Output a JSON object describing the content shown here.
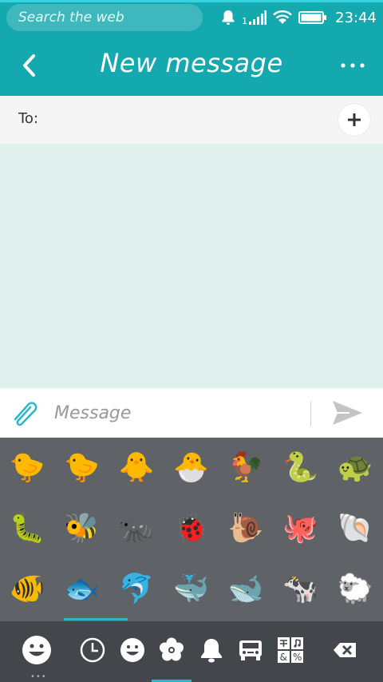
{
  "status_bar": {
    "search_placeholder": "Search the web",
    "sim_number": "1",
    "time": "23:44",
    "icons": [
      "bell-icon",
      "signal-icon",
      "wifi-icon",
      "battery-icon"
    ]
  },
  "header": {
    "title": "New message",
    "back_icon": "chevron-left-icon",
    "menu_icon": "more-horizontal-icon",
    "color": "#14a9ae"
  },
  "recipients": {
    "label": "To:",
    "add_icon": "plus-icon"
  },
  "compose": {
    "placeholder": "Message",
    "value": "",
    "attach_icon": "paperclip-icon",
    "send_icon": "send-icon"
  },
  "emoji_keyboard": {
    "emojis": [
      "🐤",
      "🐤",
      "🐥",
      "🐣",
      "🐓",
      "🐍",
      "🐢",
      "🐛",
      "🐝",
      "🐜",
      "🐞",
      "🐌",
      "🐙",
      "🐚",
      "🐠",
      "🐟",
      "🐬",
      "🐳",
      "🐋",
      "🐄",
      "🐑"
    ],
    "active_page": 2,
    "categories": [
      "recent-clock-icon",
      "smiley-icon",
      "flower-icon",
      "bell-icon",
      "car-icon",
      "symbols-icon"
    ],
    "active_category": "flower-icon",
    "switch_icon": "smiley-keyboard-icon",
    "delete_icon": "backspace-icon",
    "accent": "#2bb8c4"
  }
}
